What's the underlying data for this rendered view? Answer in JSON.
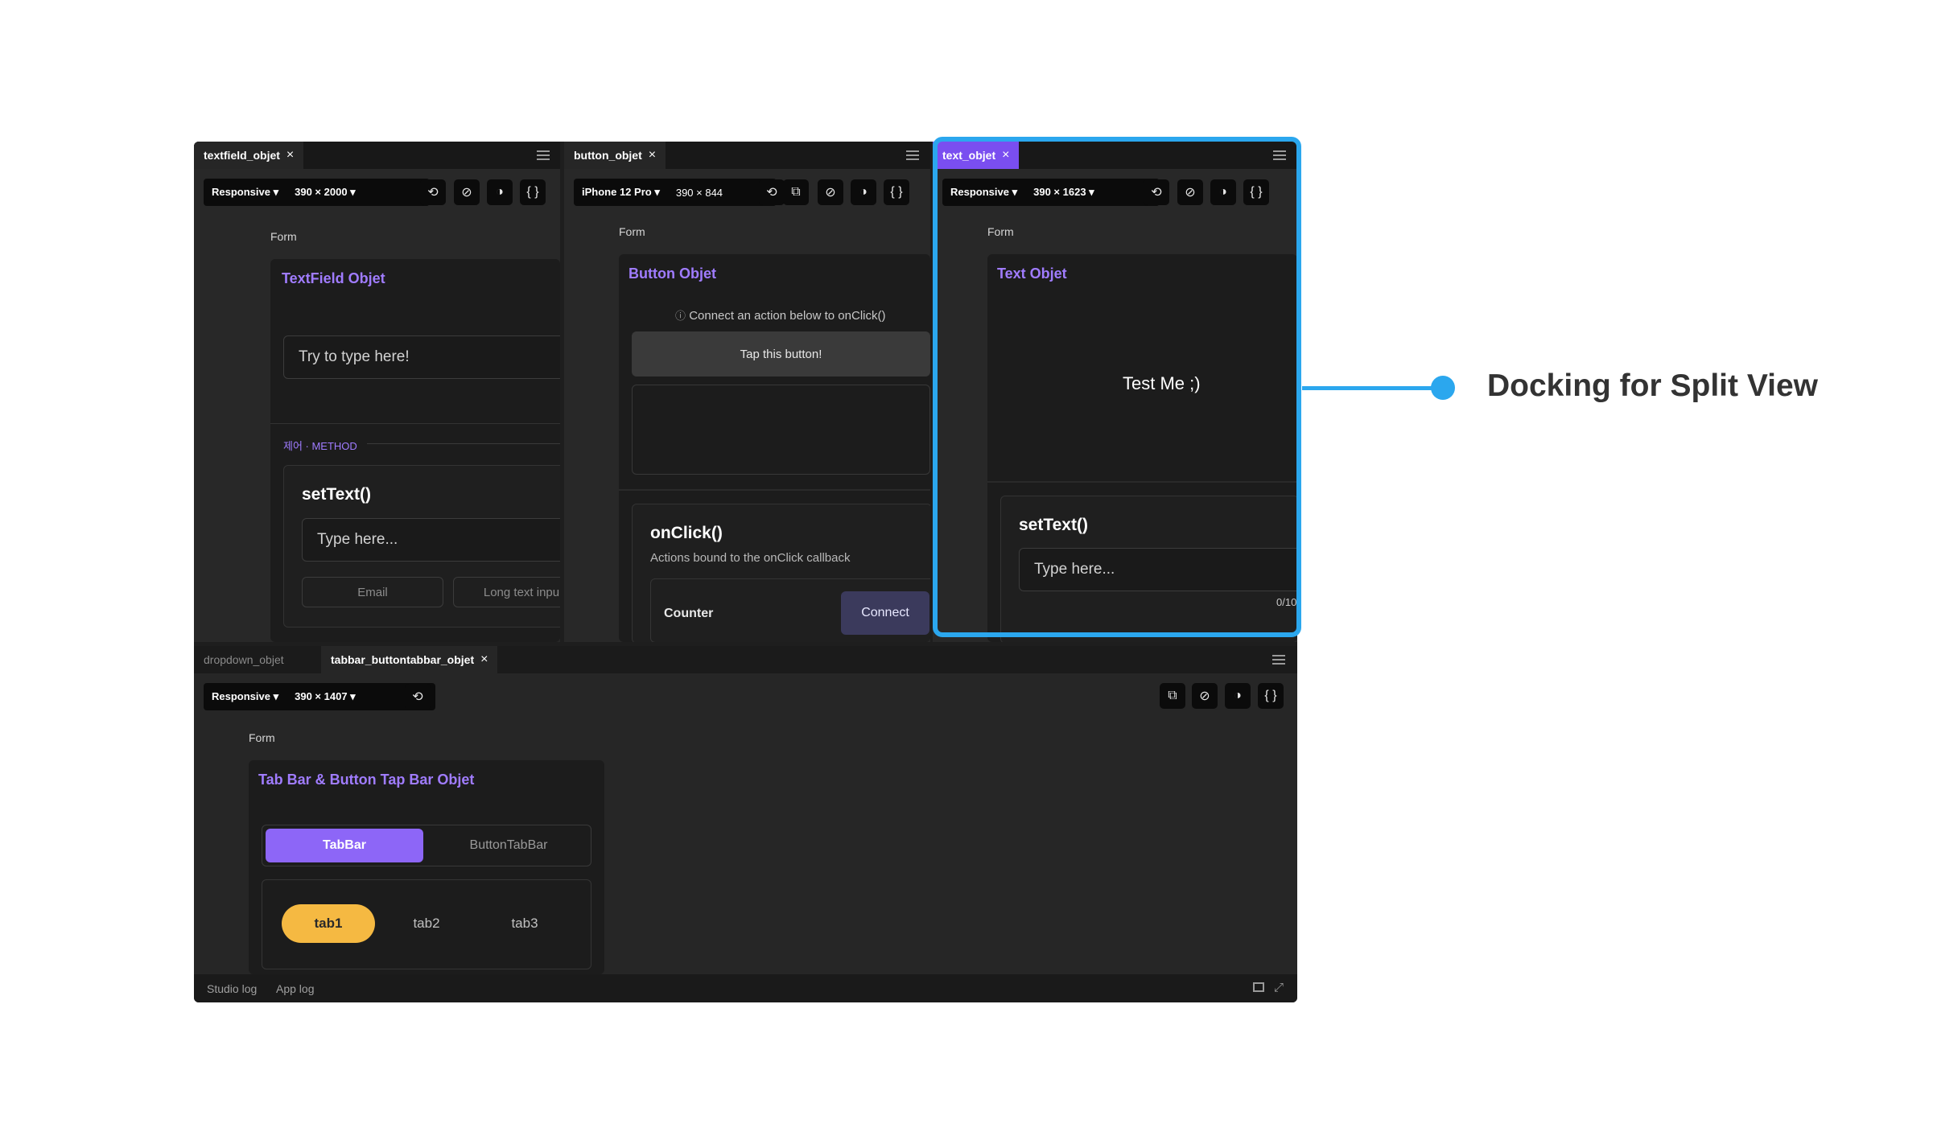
{
  "panels": {
    "textfield": {
      "tab": "textfield_objet",
      "device": "Responsive",
      "size": "390 × 2000",
      "form_label": "Form",
      "card_title": "TextField Objet",
      "input_placeholder": "Try to type here!",
      "section_label": "제어 · METHOD",
      "method_title": "setText()",
      "method_placeholder": "Type here...",
      "chips": [
        "Email",
        "Long text inpu"
      ]
    },
    "button": {
      "tab": "button_objet",
      "device": "iPhone 12 Pro",
      "size": "390 × 844",
      "form_label": "Form",
      "card_title": "Button Objet",
      "hint": "Connect an action below to onClick()",
      "button_label": "Tap this button!",
      "method_title": "onClick()",
      "method_desc": "Actions bound to the onClick callback",
      "row_label": "Counter",
      "row_action": "Connect"
    },
    "text": {
      "tab": "text_objet",
      "device": "Responsive",
      "size": "390 × 1623",
      "form_label": "Form",
      "card_title": "Text Objet",
      "sample_text": "Test Me ;)",
      "method_title": "setText()",
      "method_placeholder": "Type here...",
      "counter": "0/10"
    },
    "bottom": {
      "tabs": [
        "dropdown_objet",
        "tabbar_buttontabbar_objet"
      ],
      "device": "Responsive",
      "size": "390 × 1407",
      "form_label": "Form",
      "card_title": "Tab Bar & Button Tap Bar Objet",
      "segments": [
        "TabBar",
        "ButtonTabBar"
      ],
      "pills": [
        "tab1",
        "tab2",
        "tab3"
      ]
    }
  },
  "statusbar": {
    "studio_log": "Studio log",
    "app_log": "App log"
  },
  "callout": {
    "text": "Docking for Split View"
  },
  "colors": {
    "accent": "#7a4ef0",
    "callout": "#2ba7ee",
    "pill": "#f5b942",
    "purple_text": "#a07cff"
  }
}
